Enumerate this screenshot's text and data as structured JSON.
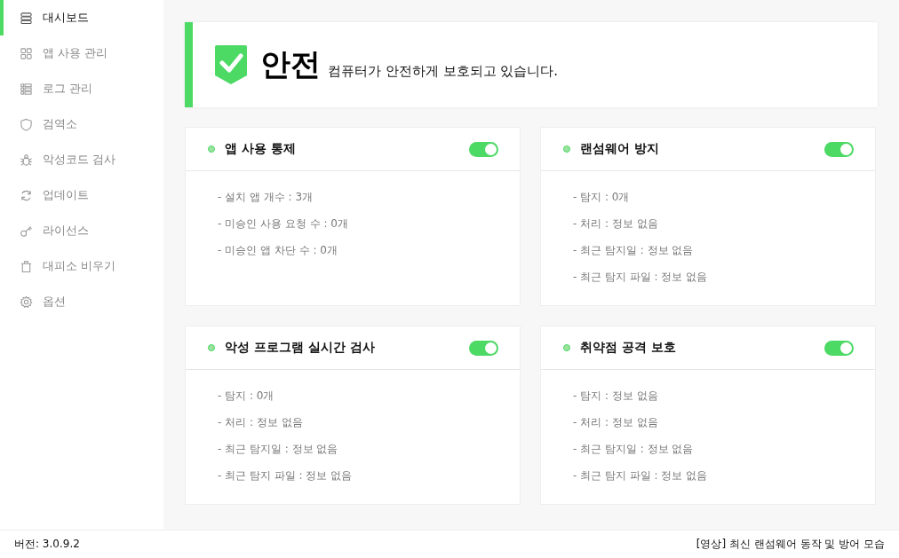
{
  "sidebar": {
    "items": [
      {
        "label": "대시보드",
        "selected": true
      },
      {
        "label": "앱 사용 관리",
        "selected": false
      },
      {
        "label": "로그 관리",
        "selected": false
      },
      {
        "label": "검역소",
        "selected": false
      },
      {
        "label": "악성코드 검사",
        "selected": false
      },
      {
        "label": "업데이트",
        "selected": false
      },
      {
        "label": "라이선스",
        "selected": false
      },
      {
        "label": "대피소 비우기",
        "selected": false
      },
      {
        "label": "옵션",
        "selected": false
      }
    ]
  },
  "status": {
    "title": "안전",
    "message": "컴퓨터가 안전하게 보호되고 있습니다."
  },
  "cards": [
    {
      "title": "앱 사용 통제",
      "on": true,
      "lines": [
        "- 설치 앱 개수 : 3개",
        "- 미승인 사용 요청 수 : 0개",
        "- 미승인 앱 차단 수 : 0개"
      ]
    },
    {
      "title": "랜섬웨어 방지",
      "on": true,
      "lines": [
        "- 탐지 : 0개",
        "- 처리 : 정보 없음",
        "- 최근 탐지일 : 정보 없음",
        "- 최근 탐지 파일 : 정보 없음"
      ]
    },
    {
      "title": "악성 프로그램 실시간 검사",
      "on": true,
      "lines": [
        "- 탐지 : 0개",
        "- 처리 : 정보 없음",
        "- 최근 탐지일 : 정보 없음",
        "- 최근 탐지 파일 : 정보 없음"
      ]
    },
    {
      "title": "취약점 공격 보호",
      "on": true,
      "lines": [
        "- 탐지 : 정보 없음",
        "- 처리 : 정보 없음",
        "- 최근 탐지일 : 정보 없음",
        "- 최근 탐지 파일 : 정보 없음"
      ]
    }
  ],
  "status_bar": {
    "version": "버전: 3.0.9.2",
    "link": "[영상] 최신 랜섬웨어 동작 및 방어 모습"
  }
}
